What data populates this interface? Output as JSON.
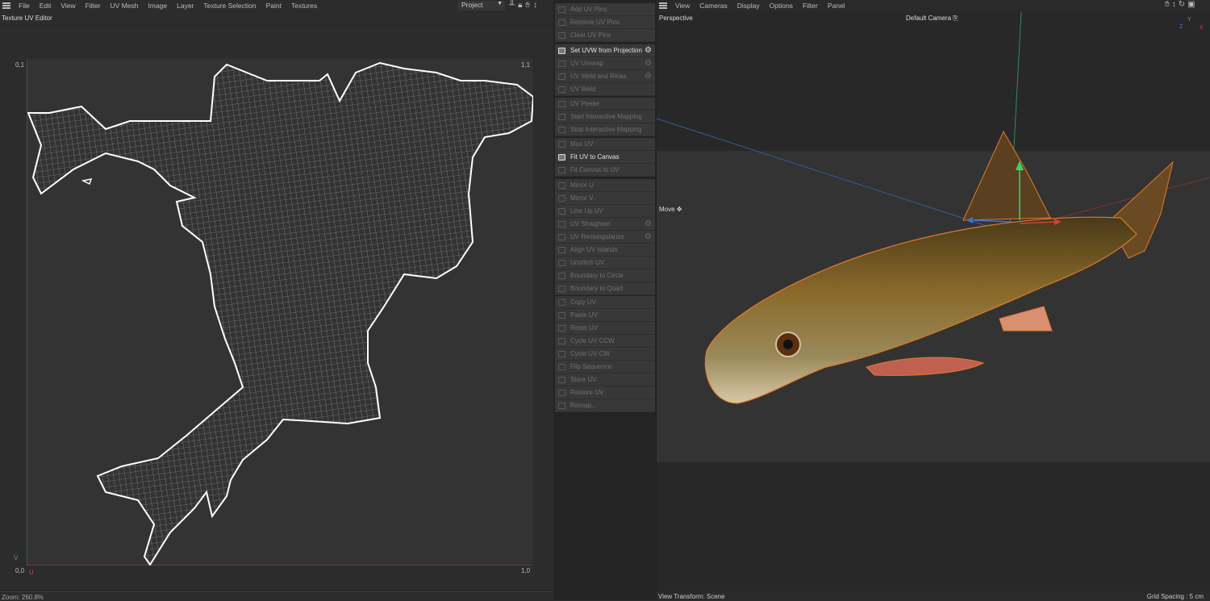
{
  "uv_editor": {
    "menu": [
      "File",
      "Edit",
      "View",
      "Filter",
      "UV Mesh",
      "Image",
      "Layer",
      "Texture Selection",
      "Paint",
      "Textures"
    ],
    "project_select": "Project",
    "title": "Texture UV Editor",
    "corner_labels": {
      "top_left": "0,1",
      "top_right": "1,1",
      "bottom_left": "0,0",
      "bottom_right": "1,0",
      "u_axis": "U",
      "v_axis": "V"
    },
    "status": "Zoom: 260.8%",
    "colors": {
      "u_axis": "#a03c3c",
      "v_axis": "#3c8a5a",
      "uv_outline": "#ffffff"
    }
  },
  "uv_commands": {
    "groups": [
      [
        {
          "label": "Add UV Pins",
          "enabled": false
        },
        {
          "label": "Remove UV Pins",
          "enabled": false
        },
        {
          "label": "Clear UV Pins",
          "enabled": false
        }
      ],
      [
        {
          "label": "Set UVW from Projection",
          "enabled": true,
          "gear": true
        },
        {
          "label": "UV Unwrap",
          "enabled": false,
          "gear": true
        },
        {
          "label": "UV Weld and Relax",
          "enabled": false,
          "gear": true
        },
        {
          "label": "UV Weld",
          "enabled": false
        }
      ],
      [
        {
          "label": "UV Peeler",
          "enabled": false
        },
        {
          "label": "Start Interactive Mapping",
          "enabled": false
        },
        {
          "label": "Stop Interactive Mapping",
          "enabled": false
        }
      ],
      [
        {
          "label": "Max UV",
          "enabled": false
        },
        {
          "label": "Fit UV to Canvas",
          "enabled": true
        },
        {
          "label": "Fit Canvas to UV",
          "enabled": false
        }
      ],
      [
        {
          "label": "Mirror U",
          "enabled": false
        },
        {
          "label": "Mirror V",
          "enabled": false
        },
        {
          "label": "Line Up UV",
          "enabled": false
        },
        {
          "label": "UV Straighten",
          "enabled": false,
          "gear": true
        },
        {
          "label": "UV Rectangularize",
          "enabled": false,
          "gear": true
        },
        {
          "label": "Align UV Islands",
          "enabled": false
        },
        {
          "label": "Unstitch UV",
          "enabled": false
        },
        {
          "label": "Boundary to Circle",
          "enabled": false
        },
        {
          "label": "Boundary to Quad",
          "enabled": false
        }
      ],
      [
        {
          "label": "Copy UV",
          "enabled": false
        },
        {
          "label": "Paste UV",
          "enabled": false
        },
        {
          "label": "Reset UV",
          "enabled": false
        },
        {
          "label": "Cycle UV CCW",
          "enabled": false
        },
        {
          "label": "Cycle UV CW",
          "enabled": false
        },
        {
          "label": "Flip Sequence",
          "enabled": false
        },
        {
          "label": "Store UV",
          "enabled": false
        },
        {
          "label": "Restore UV",
          "enabled": false
        },
        {
          "label": "Remap...",
          "enabled": false
        }
      ]
    ]
  },
  "viewport": {
    "menu": [
      "View",
      "Cameras",
      "Display",
      "Options",
      "Filter",
      "Panel"
    ],
    "view_name": "Perspective",
    "camera": "Default Camera",
    "tool": "Move",
    "axis_labels": {
      "x": "X",
      "y": "Y",
      "z": "Z"
    },
    "status_left": "View Transform: Scene",
    "status_right": "Grid Spacing : 5 cm",
    "colors": {
      "selection_outline": "#e07a2a",
      "x": "#d04040",
      "y": "#40c060",
      "z": "#4070d0"
    }
  }
}
